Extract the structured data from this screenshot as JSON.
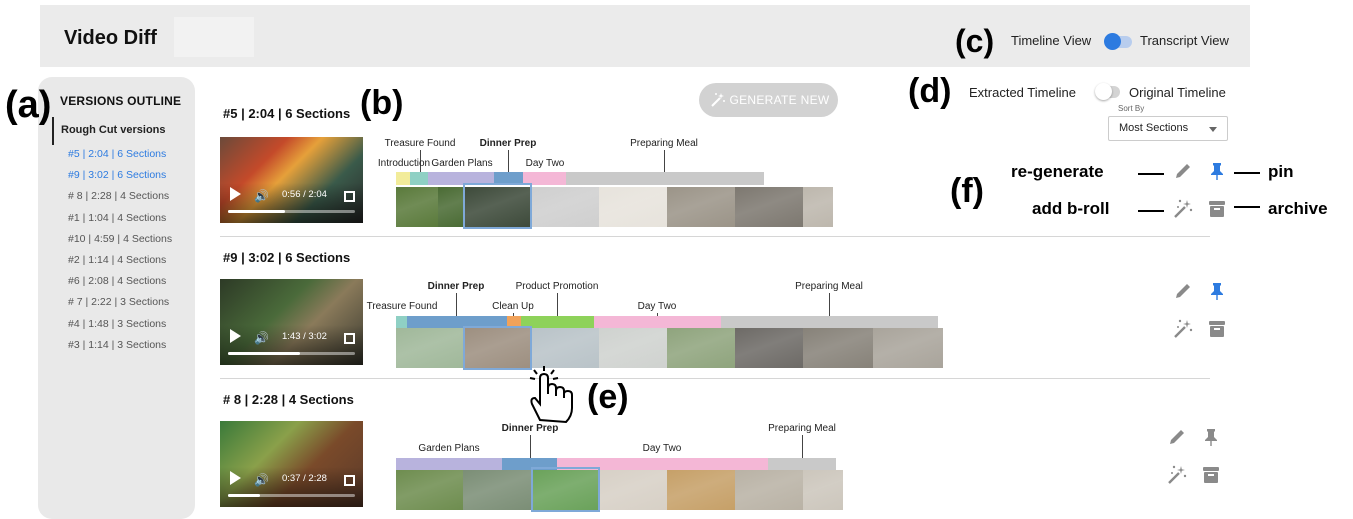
{
  "header": {
    "app_title": "Video Diff",
    "view_toggle": {
      "left_label": "Timeline View",
      "right_label": "Transcript View"
    }
  },
  "annotations": {
    "a": "(a)",
    "b": "(b)",
    "c": "(c)",
    "d": "(d)",
    "e": "(e)",
    "f": "(f)"
  },
  "sidebar": {
    "title": "VERSIONS OUTLINE",
    "group_label": "Rough Cut versions",
    "items": [
      {
        "label": "#5 | 2:04 | 6 Sections",
        "active": true
      },
      {
        "label": "#9 | 3:02 | 6 Sections",
        "active": true
      },
      {
        "label": "# 8 | 2:28 | 4 Sections",
        "active": false
      },
      {
        "label": "#1 | 1:04 | 4 Sections",
        "active": false
      },
      {
        "label": "#10 | 4:59 | 4 Sections",
        "active": false
      },
      {
        "label": "#2 | 1:14 | 4 Sections",
        "active": false
      },
      {
        "label": "#6 | 2:08 | 4 Sections",
        "active": false
      },
      {
        "label": "# 7 | 2:22 | 3 Sections",
        "active": false
      },
      {
        "label": "#4 | 1:48 | 3 Sections",
        "active": false
      },
      {
        "label": "#3 | 1:14 | 3 Sections",
        "active": false
      }
    ]
  },
  "toolbar": {
    "generate_label": "GENERATE NEW",
    "timeline_toggle": {
      "left_label": "Extracted Timeline",
      "right_label": "Original Timeline"
    },
    "sort": {
      "label": "Sort By",
      "value": "Most Sections"
    }
  },
  "legend": {
    "regenerate": "re-generate",
    "pin": "pin",
    "add_broll": "add b-roll",
    "archive": "archive"
  },
  "rows": [
    {
      "title": "#5 | 2:04 | 6 Sections",
      "time": "0:56 / 2:04",
      "progress": 0.45,
      "pinned": true,
      "labels": [
        "Treasure Found",
        "Introduction",
        "Garden Plans",
        "Dinner Prep",
        "Day Two",
        "Preparing Meal"
      ]
    },
    {
      "title": "#9 | 3:02 | 6 Sections",
      "time": "1:43 / 3:02",
      "progress": 0.57,
      "pinned": true,
      "labels": [
        "Dinner Prep",
        "Product Promotion",
        "Treasure Found",
        "Clean Up",
        "Day Two",
        "Preparing Meal"
      ]
    },
    {
      "title": "# 8 | 2:28 | 4 Sections",
      "time": "0:37 / 2:28",
      "progress": 0.25,
      "pinned": false,
      "labels": [
        "Dinner Prep",
        "Preparing Meal",
        "Garden Plans",
        "Day Two"
      ]
    }
  ],
  "colors": {
    "accent": "#2d7be0",
    "garden_plans": "#b8b3dd",
    "dinner_prep": "#6e9ecb",
    "day_two": "#f4b7d6",
    "preparing_meal": "#c9c9c9",
    "treasure_found": "#8fd0c4",
    "introduction": "#f2ec9a",
    "clean_up": "#f1a25a",
    "product_promotion": "#8ed25a"
  }
}
